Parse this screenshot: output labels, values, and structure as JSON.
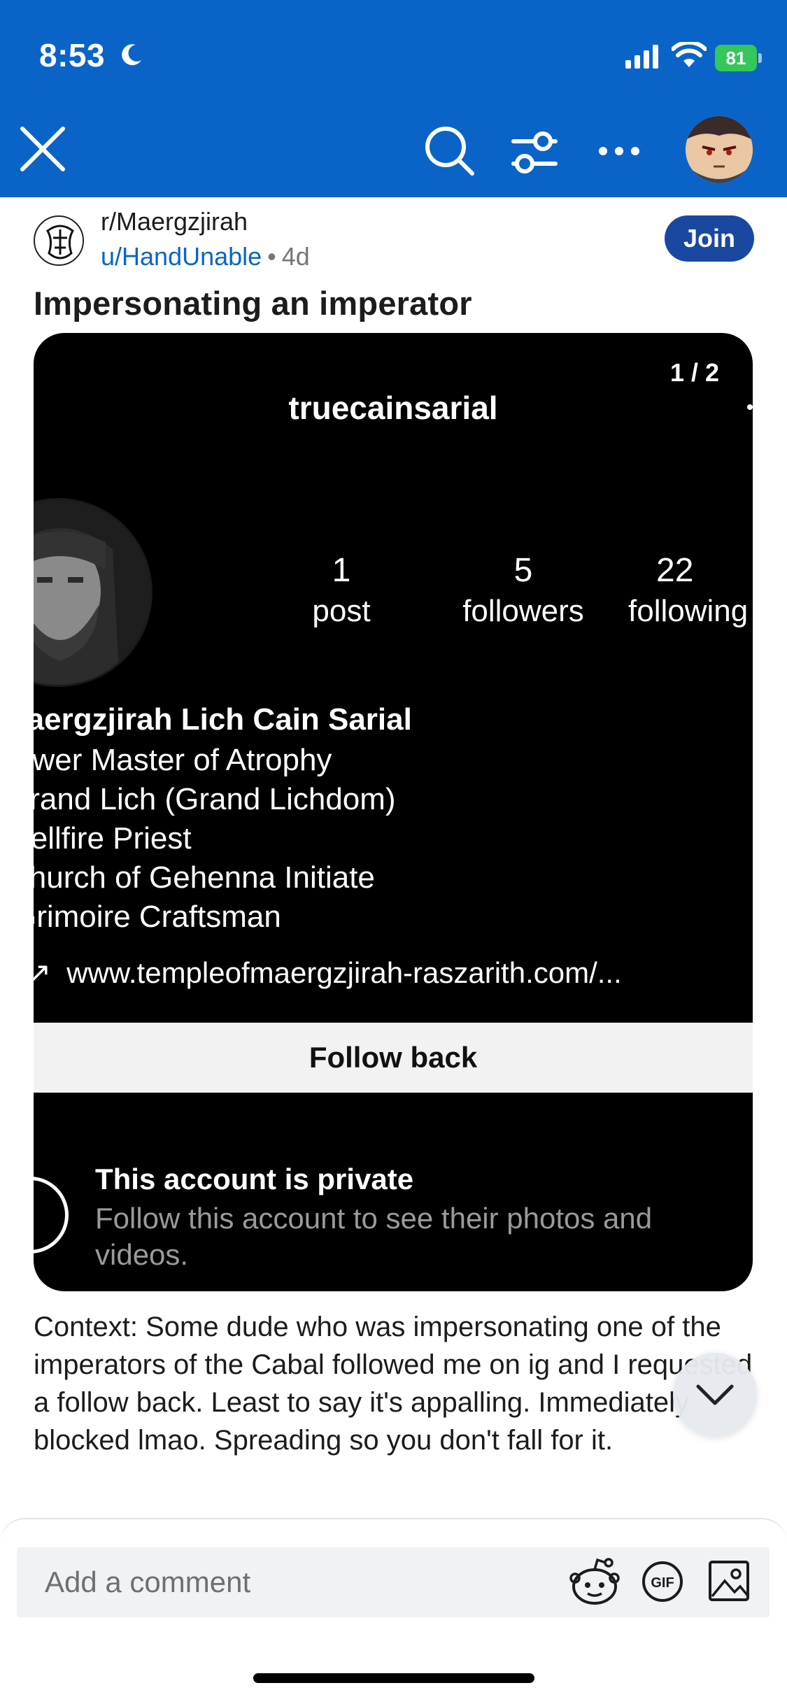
{
  "status_bar": {
    "time": "8:53",
    "battery": "81"
  },
  "toolbar": {
    "close_icon": "close-icon",
    "search_icon": "search-icon",
    "filter_icon": "filter-icon",
    "more_icon": "more-icon"
  },
  "post": {
    "subreddit": "r/Maergzjirah",
    "user": "u/HandUnable",
    "separator": "•",
    "age": "4d",
    "join_label": "Join",
    "title": "Impersonating an imperator",
    "body": "Context: Some dude who was impersonating one of the imperators of the Cabal followed me on ig and I requested a follow back. Least to say it's appalling. Immediately blocked lmao. Spreading so you don't fall for it."
  },
  "media": {
    "counter": "1 / 2",
    "profile": {
      "username": "truecainsarial",
      "stats": [
        {
          "num": "1",
          "label": "post"
        },
        {
          "num": "5",
          "label": "followers"
        },
        {
          "num": "22",
          "label": "following"
        }
      ],
      "bio_name": "Maergzjirah Lich Cain Sarial",
      "bio_lines": [
        "Tower Master of Atrophy",
        "Grand Lich (Grand Lichdom)",
        "Hellfire Priest",
        "Church of Gehenna Initiate",
        "Grimoire Craftsman"
      ],
      "link": "www.templeofmaergzjirah-raszarith.com/...",
      "follow_back": "Follow back",
      "private_title": "This account is private",
      "private_text": "Follow this account to see their photos and videos."
    }
  },
  "comment": {
    "placeholder": "Add a comment",
    "icons": [
      "snoo-icon",
      "gif-icon",
      "image-icon"
    ]
  },
  "colors": {
    "header": "#0a64c8",
    "join": "#1a48a0",
    "link": "#0a64c8"
  }
}
